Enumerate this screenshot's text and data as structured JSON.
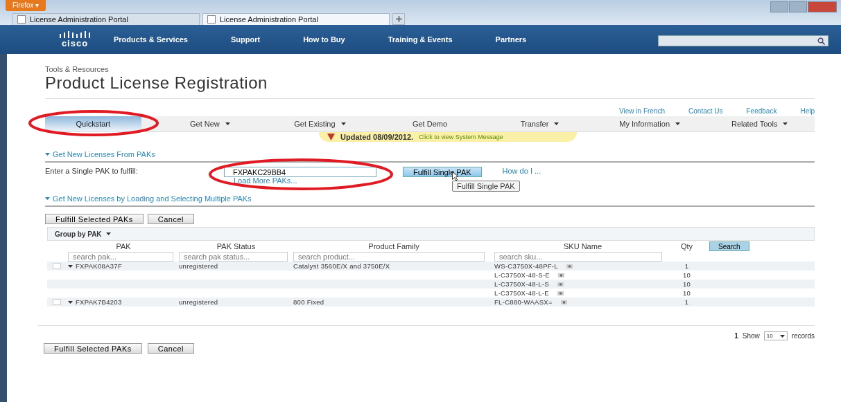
{
  "browser": {
    "menu_button": "Firefox ▾",
    "tabs": [
      {
        "title": "License Administration Portal",
        "selected": false
      },
      {
        "title": "License Administration Portal",
        "selected": true
      }
    ]
  },
  "site_nav": {
    "logo": "cisco",
    "items": [
      "Products & Services",
      "Support",
      "How to Buy",
      "Training & Events",
      "Partners"
    ]
  },
  "breadcrumb": "Tools & Resources",
  "page_title": "Product License Registration",
  "utility_links": [
    "View in French",
    "Contact Us",
    "Feedback",
    "Help"
  ],
  "tabs": [
    {
      "label": "Quickstart",
      "selected": true,
      "dropdown": false
    },
    {
      "label": "Get New",
      "selected": false,
      "dropdown": true
    },
    {
      "label": "Get Existing",
      "selected": false,
      "dropdown": true
    },
    {
      "label": "Get Demo",
      "selected": false,
      "dropdown": false
    },
    {
      "label": "Transfer",
      "selected": false,
      "dropdown": true
    },
    {
      "label": "My Information",
      "selected": false,
      "dropdown": true
    },
    {
      "label": "Related Tools",
      "selected": false,
      "dropdown": true
    }
  ],
  "system_message": {
    "title": "Updated 08/09/2012.",
    "link": "Click to view System Message"
  },
  "single_pak": {
    "section": "Get New Licenses From PAKs",
    "label": "Enter a Single PAK to fulfill:",
    "value": "FXPAKC29BB4",
    "load_more": "Load More PAKs...",
    "button": "Fulfill Single PAK",
    "help": "How do I ...",
    "tooltip": "Fulfill Single PAK"
  },
  "multi_pak": {
    "section": "Get New Licenses by Loading and Selecting Multiple PAKs",
    "buttons": [
      "Fulfill Selected PAKs",
      "Cancel"
    ],
    "group_by": "Group by PAK"
  },
  "table": {
    "columns": [
      "PAK",
      "PAK Status",
      "Product Family",
      "SKU Name",
      "Qty"
    ],
    "search_button": "Search",
    "filters": [
      {
        "placeholder": "search pak..."
      },
      {
        "placeholder": "search pak status..."
      },
      {
        "placeholder": "search product..."
      },
      {
        "placeholder": "search sku..."
      }
    ],
    "rows": [
      {
        "kind": "pak",
        "checked": false,
        "pak": "FXPAK08A37F",
        "status": "unregistered",
        "family": "Catalyst 3560E/X and 3750E/X",
        "sku": "WS-C3750X-48PF-L",
        "qty": "1"
      },
      {
        "kind": "sku",
        "sku": "L-C3750X-48-S-E",
        "qty": "10"
      },
      {
        "kind": "sku",
        "sku": "L-C3750X-48-L-S",
        "qty": "10"
      },
      {
        "kind": "sku",
        "sku": "L-C3750X-48-L-E",
        "qty": "10"
      },
      {
        "kind": "pak",
        "checked": false,
        "pak": "FXPAK7B4203",
        "status": "unregistered",
        "family": "800 Fixed",
        "sku": "FL-C880-WAASX=",
        "qty": "1"
      }
    ]
  },
  "pagination": {
    "page": "1",
    "show": "Show",
    "page_size": "10",
    "records": "records"
  },
  "bottom_buttons": [
    "Fulfill Selected PAKs",
    "Cancel"
  ]
}
